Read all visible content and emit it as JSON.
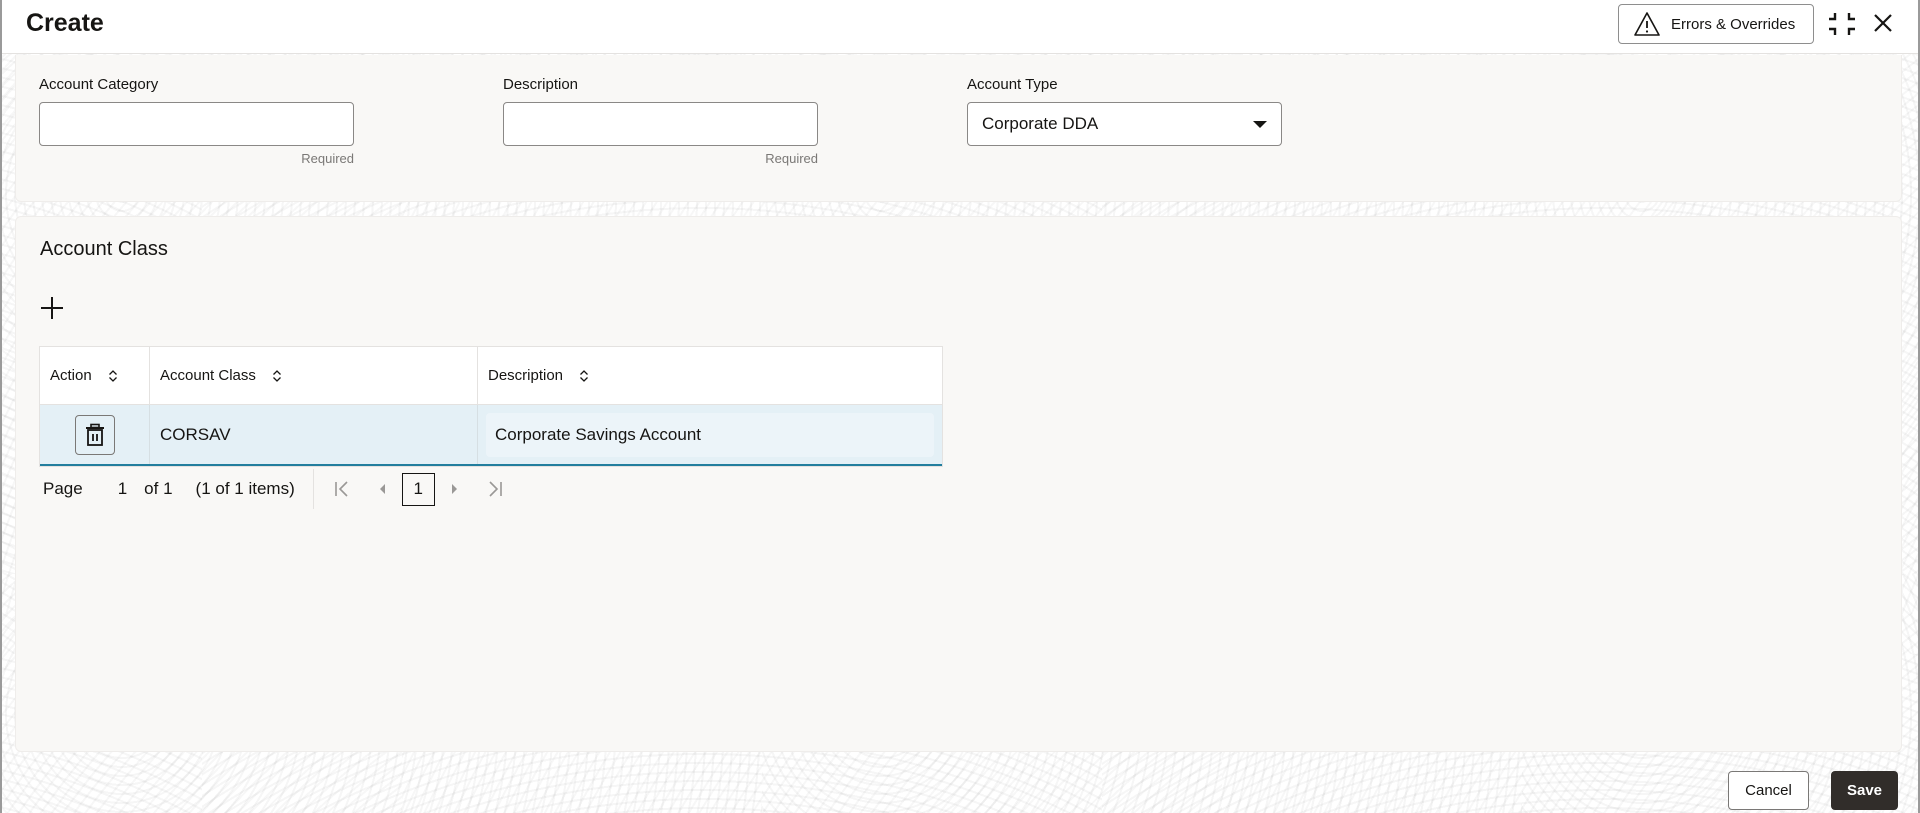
{
  "header": {
    "title": "Create",
    "errors_button_label": "Errors & Overrides",
    "icons": {
      "warning": "warning-triangle-icon",
      "compress": "compress-icon",
      "close": "close-icon"
    }
  },
  "form": {
    "account_category": {
      "label": "Account Category",
      "value": "",
      "helper": "Required"
    },
    "description": {
      "label": "Description",
      "value": "",
      "helper": "Required"
    },
    "account_type": {
      "label": "Account Type",
      "selected": "Corporate DDA"
    }
  },
  "account_class_section": {
    "title": "Account Class",
    "add_icon": "plus-icon",
    "table": {
      "columns": [
        "Action",
        "Account Class",
        "Description"
      ],
      "rows": [
        {
          "account_class": "CORSAV",
          "description": "Corporate Savings Account"
        }
      ]
    },
    "pagination": {
      "page_label": "Page",
      "current_page": "1",
      "of_label": "of 1",
      "items_summary": "(1 of 1 items)",
      "page_button": "1"
    }
  },
  "footer": {
    "cancel_label": "Cancel",
    "save_label": "Save"
  },
  "colors": {
    "primary_button": "#312d2a",
    "selected_row": "#e4f0f6",
    "row_accent": "#227e9e",
    "panel_bg": "#f9f8f6"
  }
}
